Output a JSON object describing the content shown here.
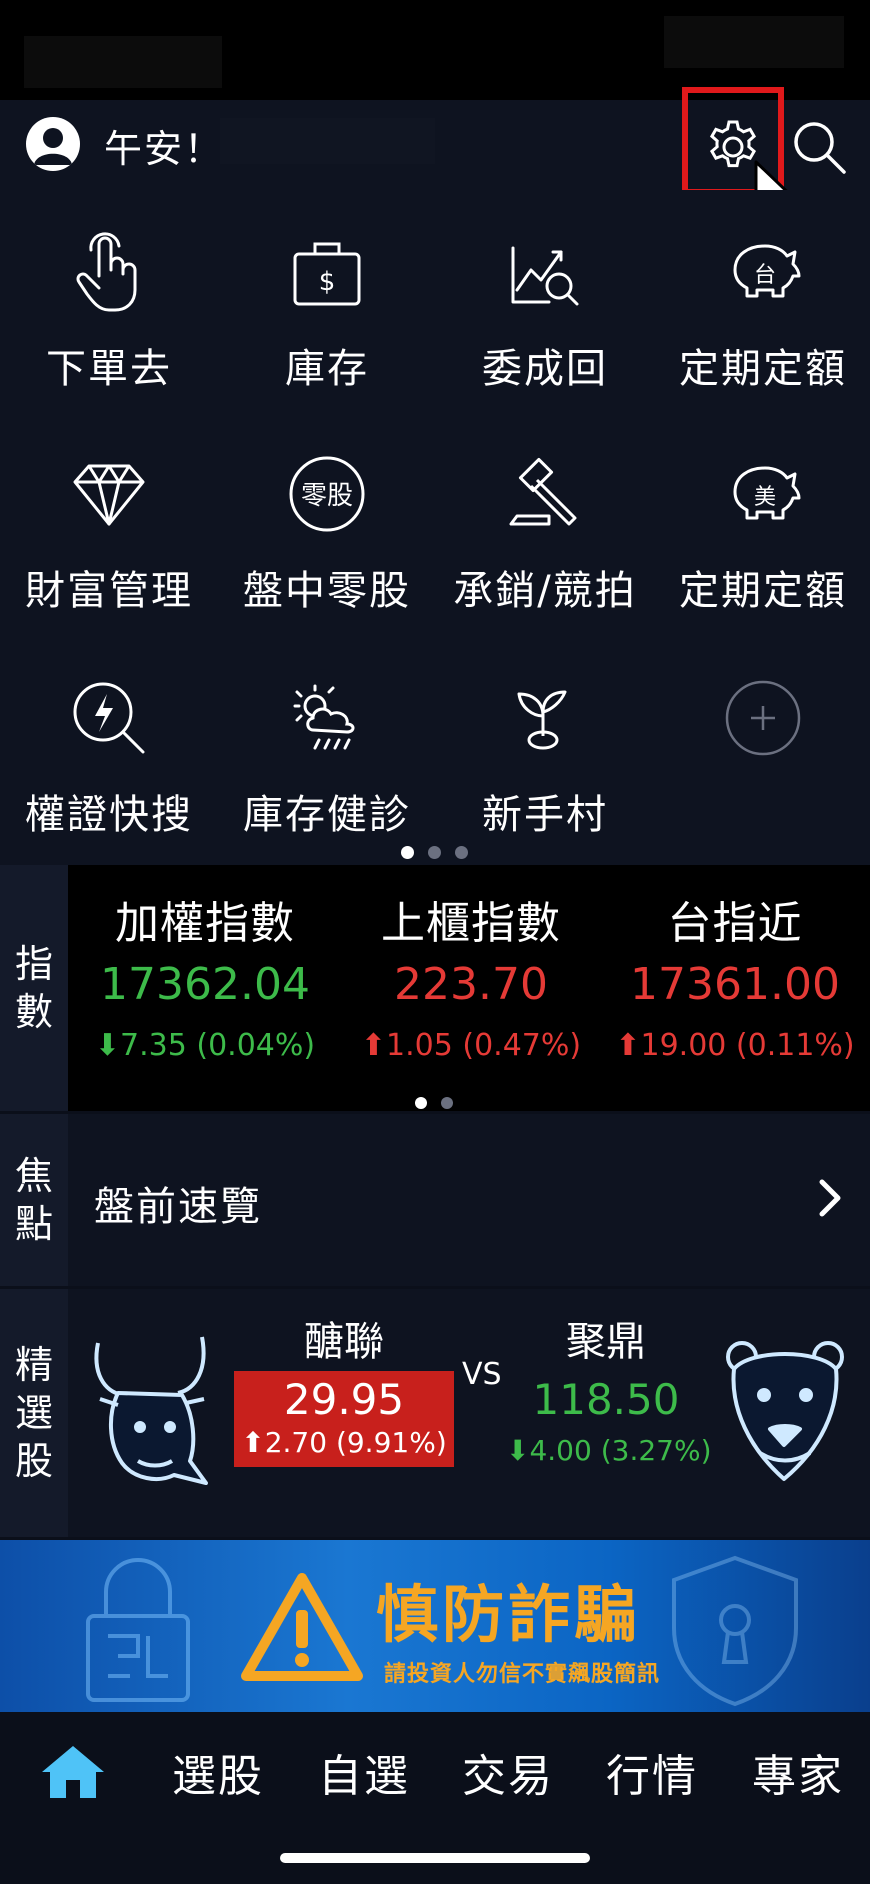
{
  "header": {
    "greeting": "午安！",
    "settings_icon": "gear-icon",
    "search_icon": "search-icon"
  },
  "shortcuts": [
    {
      "label": "下單去",
      "icon": "tap-hand-icon"
    },
    {
      "label": "庫存",
      "icon": "briefcase-dollar-icon"
    },
    {
      "label": "委成回",
      "icon": "chart-magnifier-icon"
    },
    {
      "label": "定期定額",
      "icon": "piggy-bank-tw-icon",
      "badge": "台"
    },
    {
      "label": "財富管理",
      "icon": "diamond-icon"
    },
    {
      "label": "盤中零股",
      "icon": "odd-lot-icon",
      "badge": "零股"
    },
    {
      "label": "承銷/競拍",
      "icon": "auction-gavel-icon"
    },
    {
      "label": "定期定額",
      "icon": "piggy-bank-us-icon",
      "badge": "美"
    },
    {
      "label": "權證快搜",
      "icon": "lightning-search-icon"
    },
    {
      "label": "庫存健診",
      "icon": "weather-icon"
    },
    {
      "label": "新手村",
      "icon": "sprout-icon"
    },
    {
      "label": "",
      "icon": "add-icon"
    }
  ],
  "index_section": {
    "side_label": [
      "指",
      "數"
    ],
    "items": [
      {
        "name": "加權指數",
        "value": "17362.04",
        "change": "7.35 (0.04%)",
        "dir": "down"
      },
      {
        "name": "上櫃指數",
        "value": "223.70",
        "change": "1.05 (0.47%)",
        "dir": "up"
      },
      {
        "name": "台指近",
        "value": "17361.00",
        "change": "19.00 (0.11%)",
        "dir": "up"
      }
    ]
  },
  "focus_section": {
    "side_label": [
      "焦",
      "點"
    ],
    "text": "盤前速覽"
  },
  "pick_section": {
    "side_label": [
      "精",
      "選",
      "股"
    ],
    "vs": "VS",
    "bull": {
      "name": "醣聯",
      "price": "29.95",
      "change": "2.70 (9.91%)"
    },
    "bear": {
      "name": "聚鼎",
      "price": "118.50",
      "change": "4.00 (3.27%)"
    }
  },
  "banner": {
    "title": "慎防詐騙",
    "subtitle": "請投資人勿信不實飆股簡訊",
    "icon": "warning-icon"
  },
  "tabs": [
    {
      "label": "",
      "icon": "home-icon"
    },
    {
      "label": "選股"
    },
    {
      "label": "自選"
    },
    {
      "label": "交易"
    },
    {
      "label": "行情"
    },
    {
      "label": "專家"
    }
  ],
  "colors": {
    "up": "#e53a36",
    "down": "#3dbb4a",
    "accent": "#4fc3f7",
    "highlight": "#e0191b"
  }
}
